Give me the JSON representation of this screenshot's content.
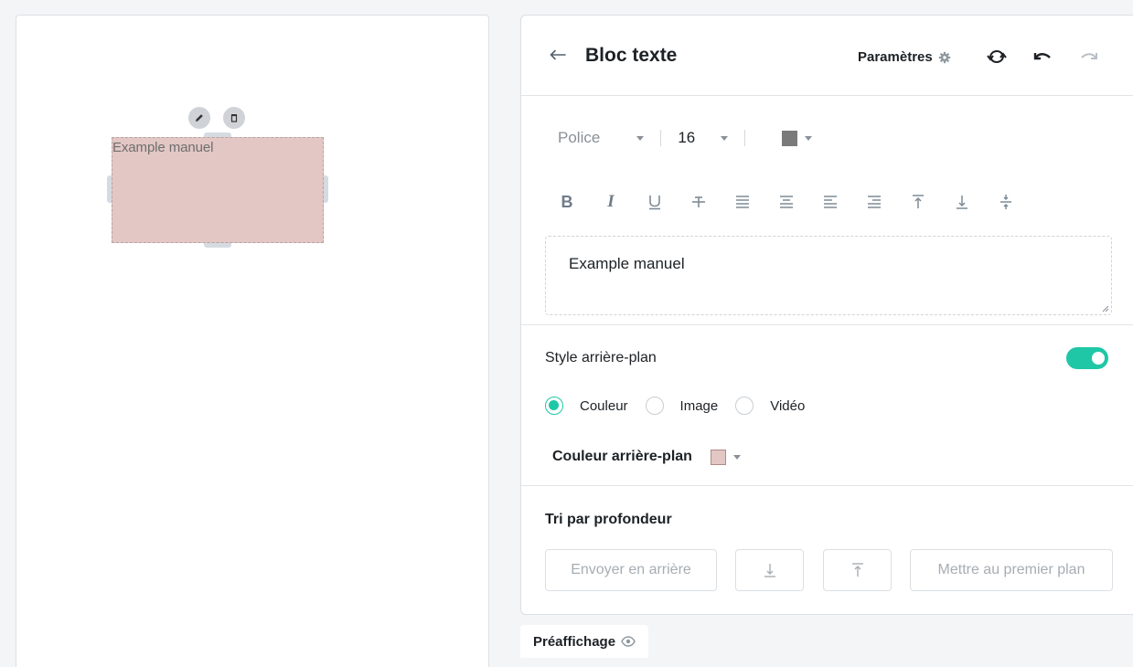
{
  "canvas": {
    "text_block": {
      "text": "Example manuel",
      "background": "#e2c7c4"
    },
    "actions": {
      "edit_icon": "pencil-icon",
      "delete_icon": "trash-icon"
    }
  },
  "panel": {
    "back_icon": "arrow-left-icon",
    "title": "Bloc texte",
    "params_label": "Paramètres",
    "params_icon": "gear-icon",
    "header_icons": [
      "refresh-icon",
      "undo-icon",
      "redo-icon"
    ],
    "font": {
      "family_label": "Police",
      "size": "16",
      "color": "#7a7a7a"
    },
    "format_buttons": [
      "bold",
      "italic",
      "underline",
      "strikethrough",
      "align-justify",
      "align-center",
      "align-left",
      "align-right",
      "valign-top",
      "valign-bottom",
      "valign-middle"
    ],
    "text_value": "Example manuel",
    "background_style": {
      "label": "Style arrière-plan",
      "enabled": true,
      "options": [
        "Couleur",
        "Image",
        "Vidéo"
      ],
      "selected": "Couleur",
      "color_label": "Couleur arrière-plan",
      "color": "#e2c7c4"
    },
    "depth": {
      "label": "Tri par profondeur",
      "send_back": "Envoyer en arrière",
      "bring_front": "Mettre au premier plan"
    }
  },
  "preview": {
    "label": "Préaffichage",
    "icon": "eye-icon"
  },
  "colors": {
    "accent": "#1fc7a6"
  }
}
